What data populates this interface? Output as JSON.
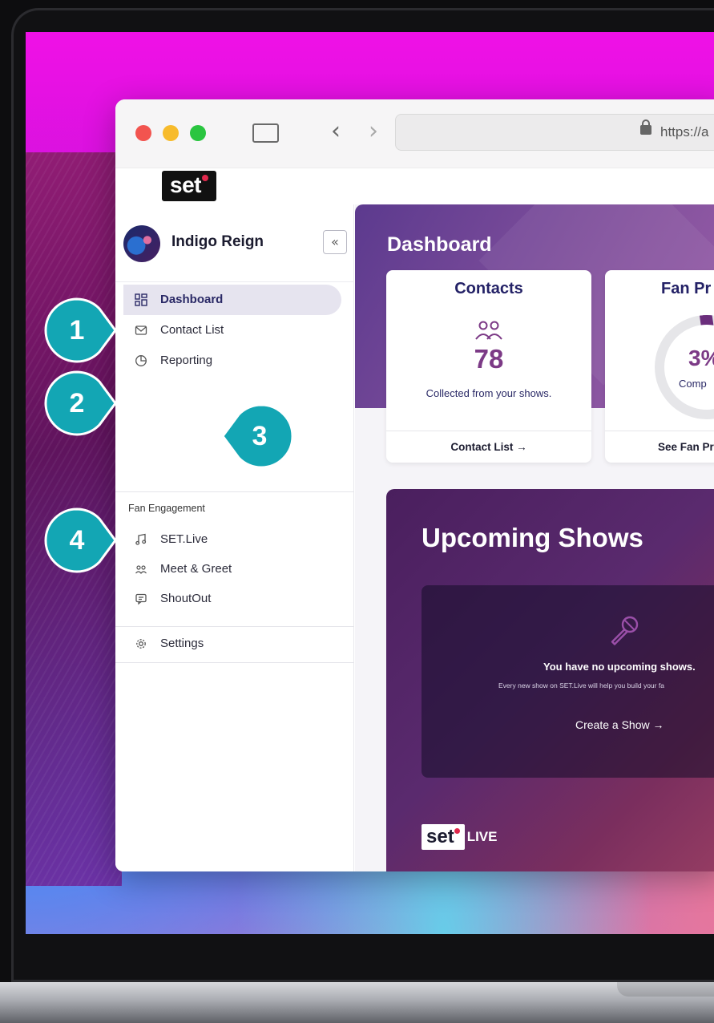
{
  "browser": {
    "url_partial": "https://a",
    "traffic_lights": {
      "close": "#f2544f",
      "minimize": "#f7bb2c",
      "zoom": "#2ac540"
    }
  },
  "app": {
    "logo_text": "set",
    "accent": "#e0284c"
  },
  "sidebar": {
    "profile_name": "Indigo Reign",
    "collapse_label": "«",
    "items": [
      {
        "label": "Dashboard",
        "icon": "dashboard-grid-icon",
        "active": true
      },
      {
        "label": "Contact List",
        "icon": "envelope-icon",
        "active": false
      },
      {
        "label": "Reporting",
        "icon": "pie-chart-icon",
        "active": false
      }
    ],
    "section_label": "Fan Engagement",
    "engagement_items": [
      {
        "label": "SET.Live",
        "icon": "music-note-icon"
      },
      {
        "label": "Meet & Greet",
        "icon": "people-icon"
      },
      {
        "label": "ShoutOut",
        "icon": "chat-icon"
      }
    ],
    "settings_label": "Settings"
  },
  "main": {
    "page_title": "Dashboard",
    "contacts_card": {
      "title": "Contacts",
      "count": "78",
      "subtitle": "Collected from your shows.",
      "link": "Contact List →"
    },
    "fan_card": {
      "title": "Fan Pr",
      "percent_text": "3%",
      "percent_value": 3,
      "ring_label": "Comp",
      "link": "See Fan Pr"
    },
    "shows": {
      "title": "Upcoming Shows",
      "empty_title": "You have no upcoming shows.",
      "empty_sub": "Every new show on SET.Live will help you build your fa",
      "create_link": "Create a Show →",
      "footer_logo": "set",
      "footer_live": "LIVE"
    }
  },
  "callouts": [
    "1",
    "2",
    "3",
    "4"
  ],
  "colors": {
    "brand_dark": "#2a2966",
    "purple": "#7c3a86",
    "teal": "#13a6b4"
  }
}
